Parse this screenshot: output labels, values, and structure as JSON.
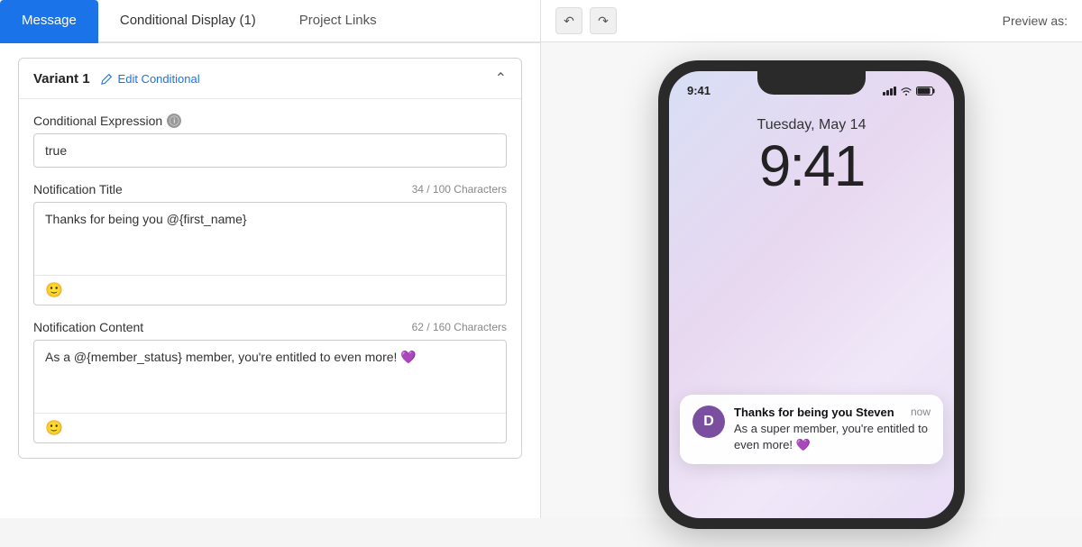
{
  "tabs": [
    {
      "id": "message",
      "label": "Message",
      "active": true
    },
    {
      "id": "conditional",
      "label": "Conditional Display (1)",
      "active": false
    },
    {
      "id": "project",
      "label": "Project Links",
      "active": false
    }
  ],
  "variant": {
    "title": "Variant 1",
    "edit_conditional_label": "Edit Conditional",
    "conditional_expression_label": "Conditional Expression",
    "conditional_expression_value": "true",
    "notification_title_label": "Notification Title",
    "notification_title_char_count": "34 / 100 Characters",
    "notification_title_value": "Thanks for being you @{first_name}",
    "notification_content_label": "Notification Content",
    "notification_content_char_count": "62 / 160 Characters",
    "notification_content_value": "As a @{member_status} member, you're entitled to even more! 💜"
  },
  "preview": {
    "label": "Preview as:",
    "phone": {
      "time": "9:41",
      "date": "Tuesday, May 14",
      "notif_avatar": "D",
      "notif_title": "Thanks for being you Steven",
      "notif_time": "now",
      "notif_message": "As a super member, you're entitled to even more! 💜"
    }
  }
}
